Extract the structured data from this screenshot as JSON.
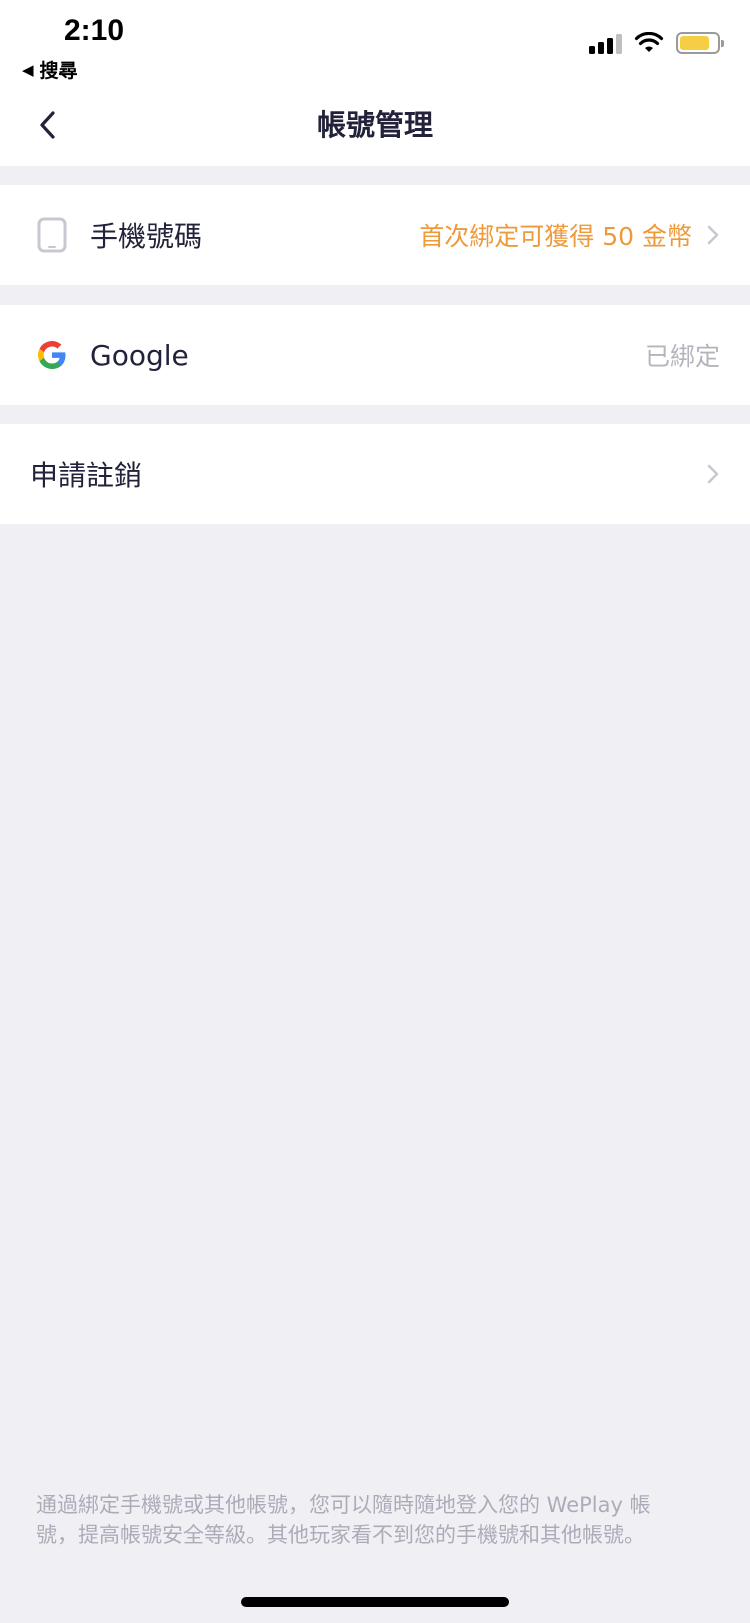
{
  "status_bar": {
    "time": "2:10",
    "back_label": "搜尋",
    "icons": [
      "signal-icon",
      "wifi-icon",
      "battery-icon"
    ],
    "battery_color": "#F5CE45"
  },
  "nav": {
    "title": "帳號管理",
    "back_icon": "chevron-left-icon"
  },
  "rows": [
    {
      "icon": "phone-icon",
      "label": "手機號碼",
      "right_text": "首次綁定可獲得 50 金幣",
      "right_color": "#EE9A3A",
      "chevron": true
    },
    {
      "icon": "google-icon",
      "label": "Google",
      "right_text": "已綁定",
      "right_color": "#B4B4BC",
      "chevron": false
    },
    {
      "icon": null,
      "label": "申請註銷",
      "right_text": "",
      "chevron": true
    }
  ],
  "footer": {
    "text": "通過綁定手機號或其他帳號，您可以隨時隨地登入您的 WePlay 帳號，提高帳號安全等級。其他玩家看不到您的手機號和其他帳號。"
  },
  "colors": {
    "background": "#F0F0F4",
    "surface": "#FFFFFF",
    "text_primary": "#22223A",
    "accent_orange": "#EE9A3A",
    "text_muted": "#B4B4BC"
  }
}
